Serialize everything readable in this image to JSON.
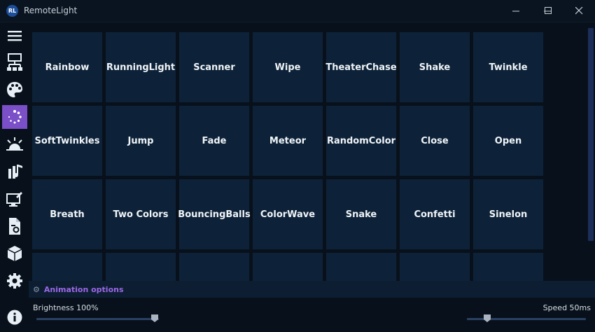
{
  "window": {
    "title": "RemoteLight",
    "logo_text": "RL"
  },
  "sidebar": {
    "items": [
      {
        "icon": "menu-icon",
        "label": "Menu"
      },
      {
        "icon": "network-icon",
        "label": "Outputs"
      },
      {
        "icon": "palette-icon",
        "label": "Colors"
      },
      {
        "icon": "animations-icon",
        "label": "Animations",
        "active": true
      },
      {
        "icon": "scenes-icon",
        "label": "Scenes"
      },
      {
        "icon": "music-icon",
        "label": "Music Sync"
      },
      {
        "icon": "screen-icon",
        "label": "Screen Color"
      },
      {
        "icon": "script-icon",
        "label": "Scripts"
      },
      {
        "icon": "cube-icon",
        "label": "Plugins"
      },
      {
        "icon": "gear-icon",
        "label": "Settings"
      },
      {
        "icon": "info-icon",
        "label": "About"
      }
    ]
  },
  "animations": [
    [
      "Rainbow",
      "RunningLight",
      "Scanner",
      "Wipe",
      "TheaterChase",
      "Shake",
      "Twinkle"
    ],
    [
      "SoftTwinkles",
      "Jump",
      "Fade",
      "Meteor",
      "RandomColor",
      "Close",
      "Open"
    ],
    [
      "Breath",
      "Two Colors",
      "BouncingBalls",
      "ColorWave",
      "Snake",
      "Confetti",
      "Sinelon"
    ],
    [
      "",
      "",
      "",
      "",
      "",
      "",
      ""
    ]
  ],
  "options": {
    "label": "Animation options"
  },
  "footer": {
    "brightness_label": "Brightness 100%",
    "brightness_value": 100,
    "speed_label": "Speed 50ms",
    "speed_value_ms": 50
  },
  "colors": {
    "accent": "#7a4fc7",
    "tile": "#0d2238",
    "background": "#08111b"
  }
}
